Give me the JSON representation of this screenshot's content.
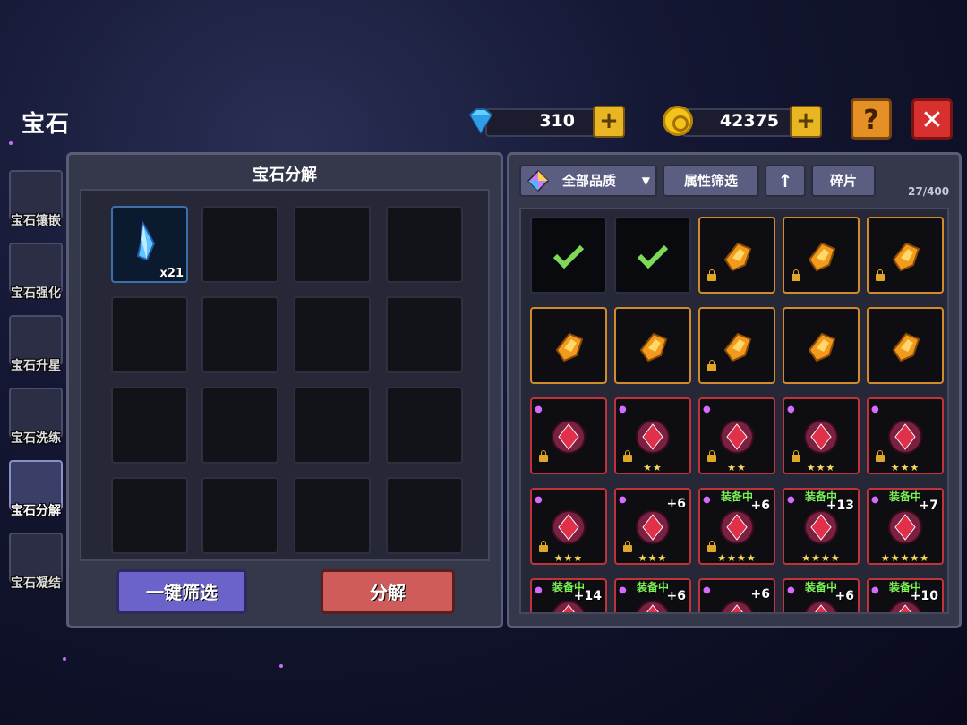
{
  "header": {
    "title": "宝石"
  },
  "currency": {
    "gems": {
      "icon": "blue-diamond-icon",
      "value": "310"
    },
    "coins": {
      "icon": "gold-coin-icon",
      "value": "42375"
    },
    "plus_label": "+"
  },
  "buttons": {
    "help": "?",
    "close": "✕"
  },
  "sidebar": {
    "tabs": [
      {
        "label": "宝石镶嵌",
        "active": false
      },
      {
        "label": "宝石强化",
        "active": false
      },
      {
        "label": "宝石升星",
        "active": false
      },
      {
        "label": "宝石洗练",
        "active": false
      },
      {
        "label": "宝石分解",
        "active": true
      },
      {
        "label": "宝石凝结",
        "active": false
      }
    ]
  },
  "decompose": {
    "title": "宝石分解",
    "slots": [
      {
        "item": "blue-crystal-shard-icon",
        "count": "x21"
      }
    ],
    "filter_button": "一键筛选",
    "decompose_button": "分解"
  },
  "inventory": {
    "quality_filter": "全部品质",
    "attr_filter": "属性筛选",
    "sort_icon": "up-arrow-icon",
    "fragments": "碎片",
    "count": "27/400",
    "items": [
      {
        "type": "selected",
        "icon": "check-icon"
      },
      {
        "type": "selected",
        "icon": "check-icon"
      },
      {
        "type": "shard",
        "locked": true
      },
      {
        "type": "shard",
        "locked": true
      },
      {
        "type": "shard",
        "locked": true
      },
      {
        "type": "shard",
        "locked": false
      },
      {
        "type": "shard",
        "locked": false
      },
      {
        "type": "shard",
        "locked": true
      },
      {
        "type": "shard",
        "locked": false
      },
      {
        "type": "shard",
        "locked": false
      },
      {
        "type": "gem",
        "locked": true,
        "stars": "",
        "level": "",
        "tag": ""
      },
      {
        "type": "gem",
        "locked": true,
        "stars": "★★",
        "level": "",
        "tag": ""
      },
      {
        "type": "gem",
        "locked": true,
        "stars": "★★",
        "level": "",
        "tag": ""
      },
      {
        "type": "gem",
        "locked": true,
        "stars": "★★★",
        "level": "",
        "tag": ""
      },
      {
        "type": "gem",
        "locked": true,
        "stars": "★★★",
        "level": "",
        "tag": ""
      },
      {
        "type": "gem",
        "locked": true,
        "stars": "★★★",
        "level": "",
        "tag": ""
      },
      {
        "type": "gem",
        "locked": true,
        "stars": "★★★",
        "level": "+6",
        "tag": ""
      },
      {
        "type": "gem",
        "locked": true,
        "stars": "★★★★",
        "level": "+6",
        "tag": "装备中"
      },
      {
        "type": "gem",
        "locked": false,
        "stars": "★★★★",
        "level": "+13",
        "tag": "装备中"
      },
      {
        "type": "gem",
        "locked": false,
        "stars": "★★★★★",
        "level": "+7",
        "tag": "装备中"
      },
      {
        "type": "gem",
        "locked": false,
        "stars": "",
        "level": "+14",
        "tag": "装备中"
      },
      {
        "type": "gem",
        "locked": false,
        "stars": "",
        "level": "+6",
        "tag": "装备中"
      },
      {
        "type": "gem",
        "locked": false,
        "stars": "",
        "level": "+6",
        "tag": ""
      },
      {
        "type": "gem",
        "locked": false,
        "stars": "",
        "level": "+6",
        "tag": "装备中"
      },
      {
        "type": "gem",
        "locked": false,
        "stars": "",
        "level": "+10",
        "tag": "装备中"
      }
    ]
  }
}
